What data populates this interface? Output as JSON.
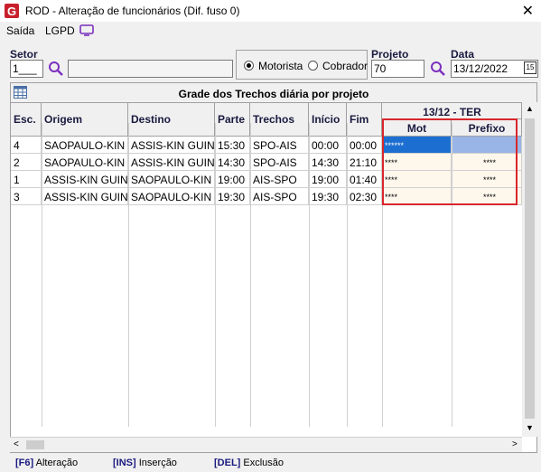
{
  "window": {
    "title": "ROD - Alteração de funcionários (Dif. fuso 0)"
  },
  "menu": {
    "saida": "Saída",
    "lgpd": "LGPD"
  },
  "filters": {
    "setor_label": "Setor",
    "setor_value": "1___",
    "setor_desc": "",
    "radio_motorista": "Motorista",
    "radio_cobrador": "Cobrador",
    "selected_radio": "Motorista",
    "projeto_label": "Projeto",
    "projeto_value": "70",
    "data_label": "Data",
    "data_value": "13/12/2022"
  },
  "grid": {
    "caption": "Grade dos Trechos diária por projeto",
    "day_header": "13/12 - TER",
    "columns": [
      "Esc.",
      "Origem",
      "Destino",
      "Parte",
      "Trechos",
      "Início",
      "Fim",
      "Mot",
      "Prefixo"
    ],
    "rows": [
      [
        "4",
        "SAOPAULO-KIN ...",
        "ASSIS-KIN GUIN",
        "15:30",
        "SPO-AIS",
        "00:00",
        "00:00",
        "******",
        ""
      ],
      [
        "2",
        "SAOPAULO-KIN ...",
        "ASSIS-KIN GUIN",
        "14:30",
        "SPO-AIS",
        "14:30",
        "21:10",
        "****",
        "****"
      ],
      [
        "1",
        "ASSIS-KIN GUIN",
        "SAOPAULO-KIN ...",
        "19:00",
        "AIS-SPO",
        "19:00",
        "01:40",
        "****",
        "****"
      ],
      [
        "3",
        "ASSIS-KIN GUIN",
        "SAOPAULO-KIN ...",
        "19:30",
        "AIS-SPO",
        "19:30",
        "02:30",
        "****",
        "****"
      ]
    ]
  },
  "status": {
    "f6_key": "[F6]",
    "f6_label": "Alteração",
    "ins_key": "[INS]",
    "ins_label": "Inserção",
    "del_key": "[DEL]",
    "del_label": "Exclusão"
  },
  "colors": {
    "accent": "#7b2fbe",
    "highlight": "#d9262c",
    "selected_cell": "#1c6fd1",
    "selected_row": "#99b4e6"
  }
}
